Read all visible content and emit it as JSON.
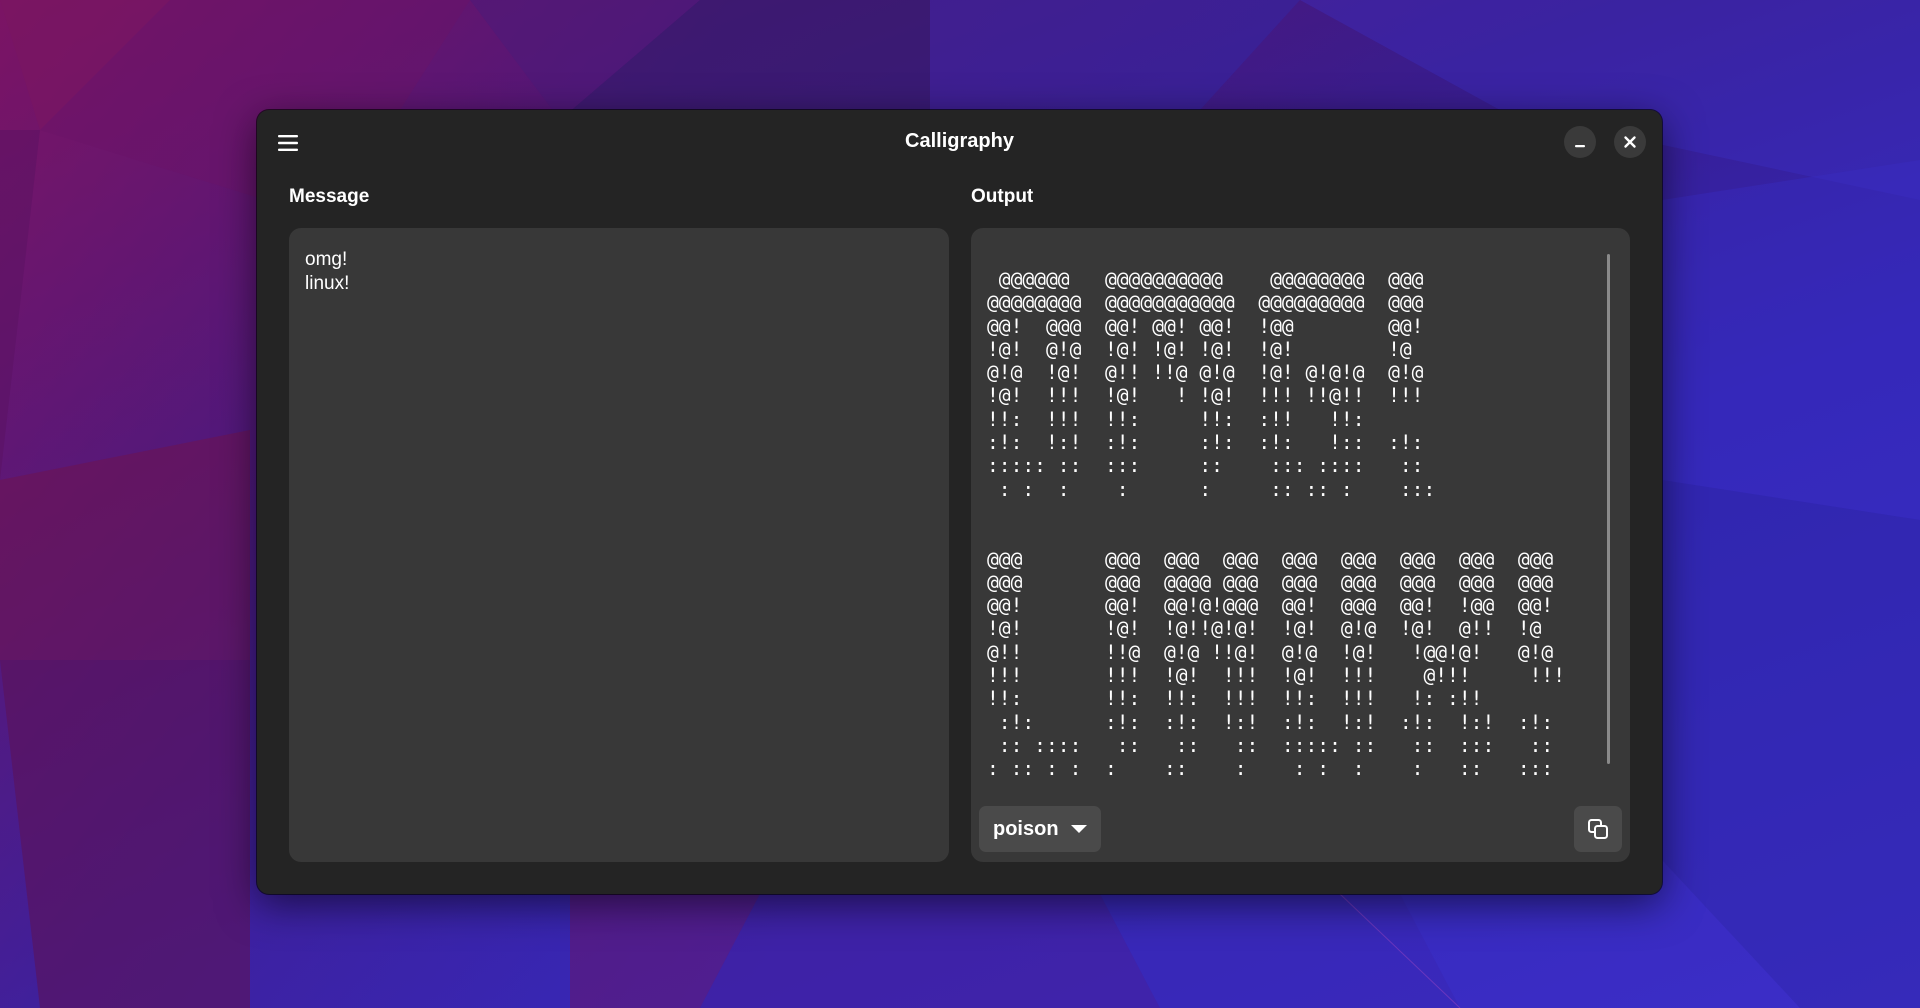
{
  "window": {
    "title": "Calligraphy"
  },
  "message": {
    "label": "Message",
    "text": "omg!\nlinux!"
  },
  "output": {
    "label": "Output",
    "ascii": " @@@@@@   @@@@@@@@@@    @@@@@@@@  @@@\n@@@@@@@@  @@@@@@@@@@@  @@@@@@@@@  @@@\n@@!  @@@  @@! @@! @@!  !@@        @@!\n!@!  @!@  !@! !@! !@!  !@!        !@\n@!@  !@!  @!! !!@ @!@  !@! @!@!@  @!@\n!@!  !!!  !@!   ! !@!  !!! !!@!!  !!!\n!!:  !!!  !!:     !!:  :!!   !!:\n:!:  !:!  :!:     :!:  :!:   !::  :!:\n::::: ::  :::     ::    ::: ::::   ::\n : :  :    :      :     :: :: :    :::\n\n\n@@@       @@@  @@@  @@@  @@@  @@@  @@@  @@@  @@@\n@@@       @@@  @@@@ @@@  @@@  @@@  @@@  @@@  @@@\n@@!       @@!  @@!@!@@@  @@!  @@@  @@!  !@@  @@!\n!@!       !@!  !@!!@!@!  !@!  @!@  !@!  @!!  !@\n@!!       !!@  @!@ !!@!  @!@  !@!   !@@!@!   @!@\n!!!       !!!  !@!  !!!  !@!  !!!    @!!!     !!!\n!!:       !!:  !!:  !!!  !!:  !!!   !: :!!\n :!:      :!:  :!:  !:!  :!:  !:!  :!:  !:!  :!:\n :: ::::   ::   ::   ::  ::::: ::   ::  :::   ::\n: :: : :  :    ::    :    : :  :    :   ::   :::",
    "font": "poison"
  },
  "icons": {
    "menu": "hamburger-menu-icon",
    "minimize": "minimize-icon",
    "close": "close-icon",
    "dropdown": "caret-down-icon",
    "copy": "copy-icon"
  }
}
